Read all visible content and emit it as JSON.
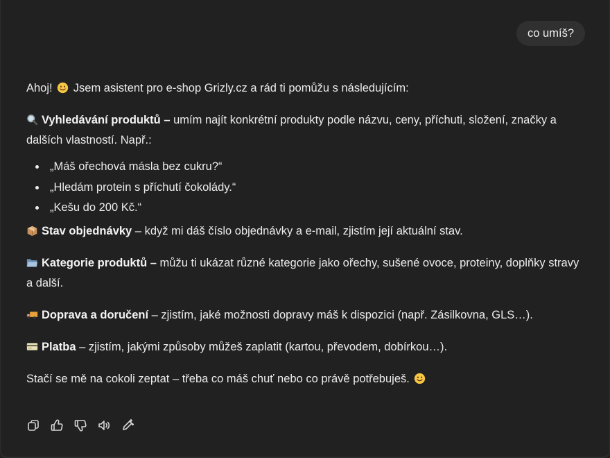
{
  "user_message": "co umíš?",
  "assistant": {
    "intro": "Ahoj! 😊 Jsem asistent pro e-shop Grizly.cz a rád ti pomůžu s následujícím:",
    "intro_before": "Ahoj!",
    "intro_after": "Jsem asistent pro e-shop Grizly.cz a rád ti pomůžu s následujícím:",
    "search": {
      "icon": "magnifier-emoji",
      "title": "Vyhledávání produktů –",
      "text": "umím najít konkrétní produkty podle názvu, ceny, příchuti, složení, značky a dalších vlastností. Např.:"
    },
    "examples": [
      "„Máš ořechová másla bez cukru?“",
      "„Hledám protein s příchutí čokolády.“",
      "„Kešu do 200 Kč.“"
    ],
    "order": {
      "icon": "package-emoji",
      "title": "Stav objednávky",
      "text": "– když mi dáš číslo objednávky a e-mail, zjistím její aktuální stav."
    },
    "categories": {
      "icon": "open-folder-emoji",
      "title": "Kategorie produktů –",
      "text": "můžu ti ukázat různé kategorie jako ořechy, sušené ovoce, proteiny, doplňky stravy a další."
    },
    "shipping": {
      "icon": "delivery-truck-emoji",
      "title": "Doprava a doručení",
      "text": "– zjistím, jaké možnosti dopravy máš k dispozici (např. Zásilkovna, GLS…)."
    },
    "payment": {
      "icon": "credit-card-emoji",
      "title": "Platba",
      "text": "– zjistím, jakými způsoby můžeš zaplatit (kartou, převodem, dobírkou…)."
    },
    "outro": "Stačí se mě na cokoli zeptat – třeba co máš chuť nebo co právě potřebuješ."
  },
  "actions": [
    "copy-icon",
    "thumbs-up-icon",
    "thumbs-down-icon",
    "read-aloud-icon",
    "edit-icon"
  ]
}
